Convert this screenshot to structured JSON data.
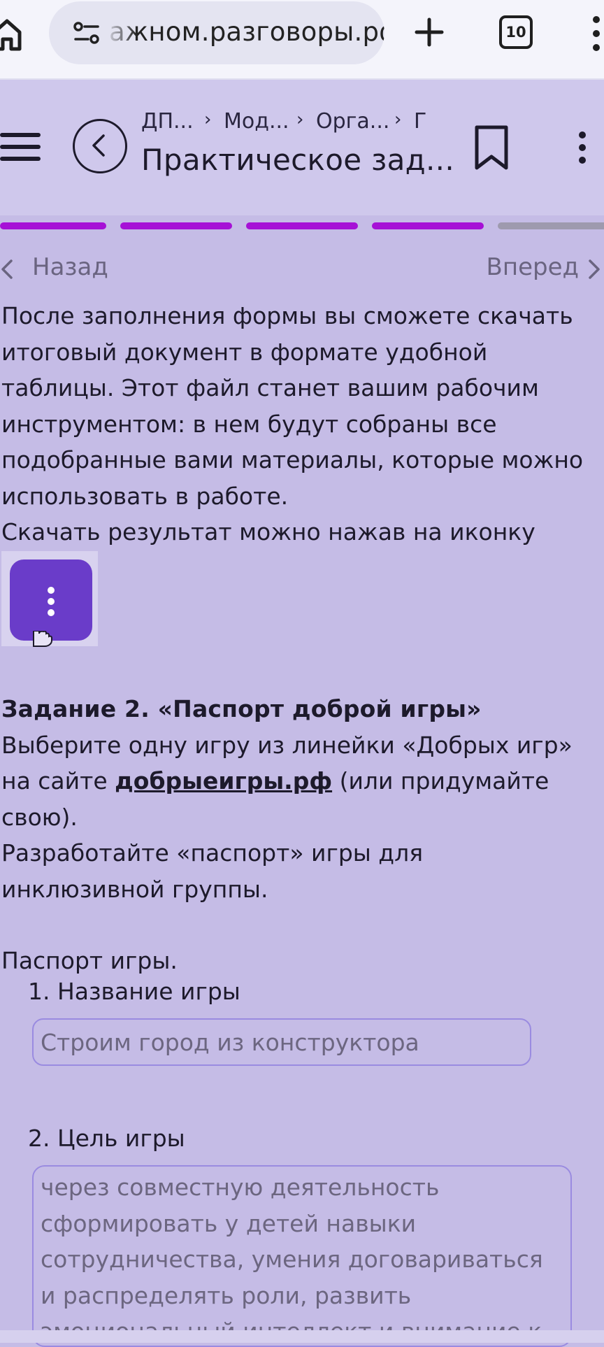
{
  "browser": {
    "url": "ажном.разговоры.рф",
    "tab_count": "10"
  },
  "header": {
    "breadcrumb": [
      "ДП...",
      "Мод...",
      "Орга...",
      "Г"
    ],
    "title": "Практическое зад..."
  },
  "progress": {
    "segments": [
      {
        "state": "done",
        "color": "#a611d6"
      },
      {
        "state": "done",
        "color": "#a611d6"
      },
      {
        "state": "done",
        "color": "#a611d6"
      },
      {
        "state": "done",
        "color": "#a611d6"
      },
      {
        "state": "todo",
        "color": "#9e9aae"
      }
    ]
  },
  "nav": {
    "back_label": "Назад",
    "next_label": "Вперед"
  },
  "content": {
    "intro": "После заполнения формы вы сможете скачать итоговый документ в формате удобной таблицы. Этот файл станет вашим рабочим инструментом: в нем будут собраны все подобранные вами материалы, которые можно использовать в работе.",
    "download_hint": "Скачать результат можно нажав на иконку",
    "task_title": "Задание 2. «Паспорт доброй игры»",
    "task_text_before_link": "Выберите одну игру из линейки «Добрых игр» на сайте ",
    "task_link": "добрыеигры.рф",
    "task_text_after_link": " (или придумайте свою).",
    "task_text_2": "Разработайте «паспорт» игры для инклюзивной группы.",
    "passport_title": "Паспорт игры.",
    "field1_label": "1. Название игры",
    "field1_value": "Строим город из конструктора",
    "field2_label": "2. Цель игры",
    "field2_value": "через совместную деятельность сформировать у детей навыки сотрудничества, умения договариваться и распределять роли, развить эмоциональный интеллект и внимание к"
  },
  "colors": {
    "page_bg": "#c5bce6",
    "header_bg": "#cfc8ec",
    "accent": "#a611d6",
    "icon_button": "#6a3cc9"
  }
}
